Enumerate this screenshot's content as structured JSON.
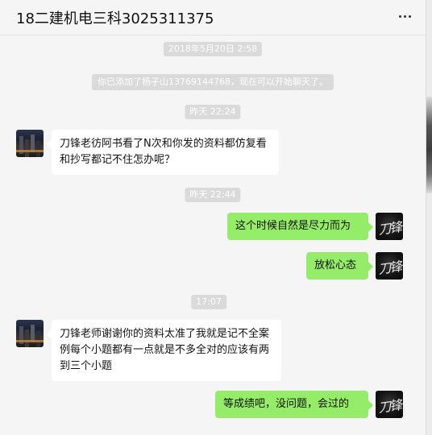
{
  "header": {
    "title": "18二建机电三科3025311375",
    "more_icon": "more-horizontal-icon"
  },
  "chat": {
    "timestamps": [
      "2018年5月20日 2:58",
      "昨天 22:24",
      "昨天 22:44",
      "17:07"
    ],
    "system_notice": "你已添加了杨子山13769144768，现在可以开始聊天了。",
    "messages": [
      {
        "from": "contact",
        "text": "刀锋老彷阿书看了N次和你发的资料都仿复看和抄写都记不住怎办呢？"
      },
      {
        "from": "me",
        "text": "这个时候自然是尽力而为"
      },
      {
        "from": "me",
        "text": "放松心态"
      },
      {
        "from": "contact",
        "text": "刀锋老师谢谢你的资料太准了我就是记不全案例每个小题都有一点就是不多全对的应该有两到三个小题"
      },
      {
        "from": "me",
        "text": "等成绩吧，没问题，会过的"
      }
    ],
    "avatar_right_glyph": "刀锋"
  },
  "colors": {
    "background": "#f5f5f5",
    "bubble_out": "#95ec69",
    "bubble_in": "#ffffff",
    "chip": "#dadada"
  }
}
